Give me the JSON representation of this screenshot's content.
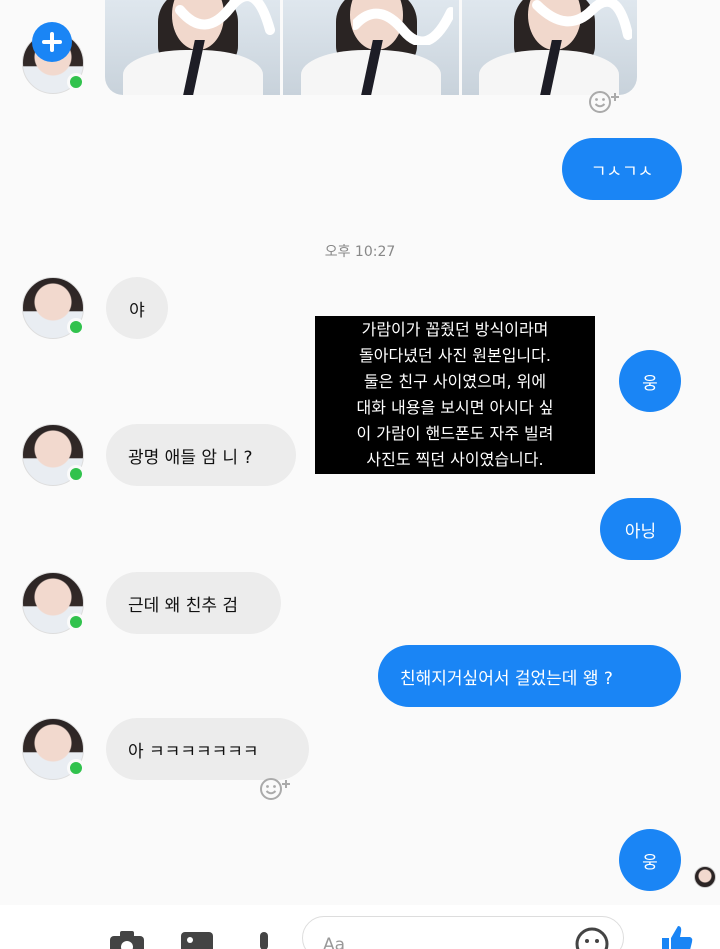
{
  "messages": {
    "out_1": "ㄱㅅㄱㅅ",
    "timestamp": "오후 10:27",
    "in_1": "야",
    "out_2": "웅",
    "in_2": "광명 애들 암 니 ?",
    "out_3": "아닝",
    "in_3": "근데 왜 친추 검",
    "out_4": "친해지거싶어서 걸었는데 왱 ?",
    "in_4": "아 ㅋㅋㅋㅋㅋㅋㅋ",
    "out_5": "웅"
  },
  "overlay_lines": [
    "가람이가 꼽줬던 방식이라며",
    "돌아다녔던 사진 원본입니다.",
    "둘은 친구 사이였으며, 위에",
    "대화 내용을 보시면 아시다 싶",
    "이 가람이 핸드폰도 자주 빌려",
    "사진도 찍던 사이였습니다."
  ],
  "composer": {
    "placeholder": "Aa"
  },
  "icons": {
    "react": "emoji-add-icon",
    "plus": "plus-icon",
    "camera": "camera-icon",
    "gallery": "image-icon",
    "mic": "microphone-icon",
    "emoji": "smiley-icon",
    "like": "thumbs-up-icon"
  },
  "colors": {
    "outgoing_bubble": "#1a85f5",
    "incoming_bubble": "#ececec",
    "online_dot": "#31c24d",
    "overlay_bg": "#000000"
  }
}
